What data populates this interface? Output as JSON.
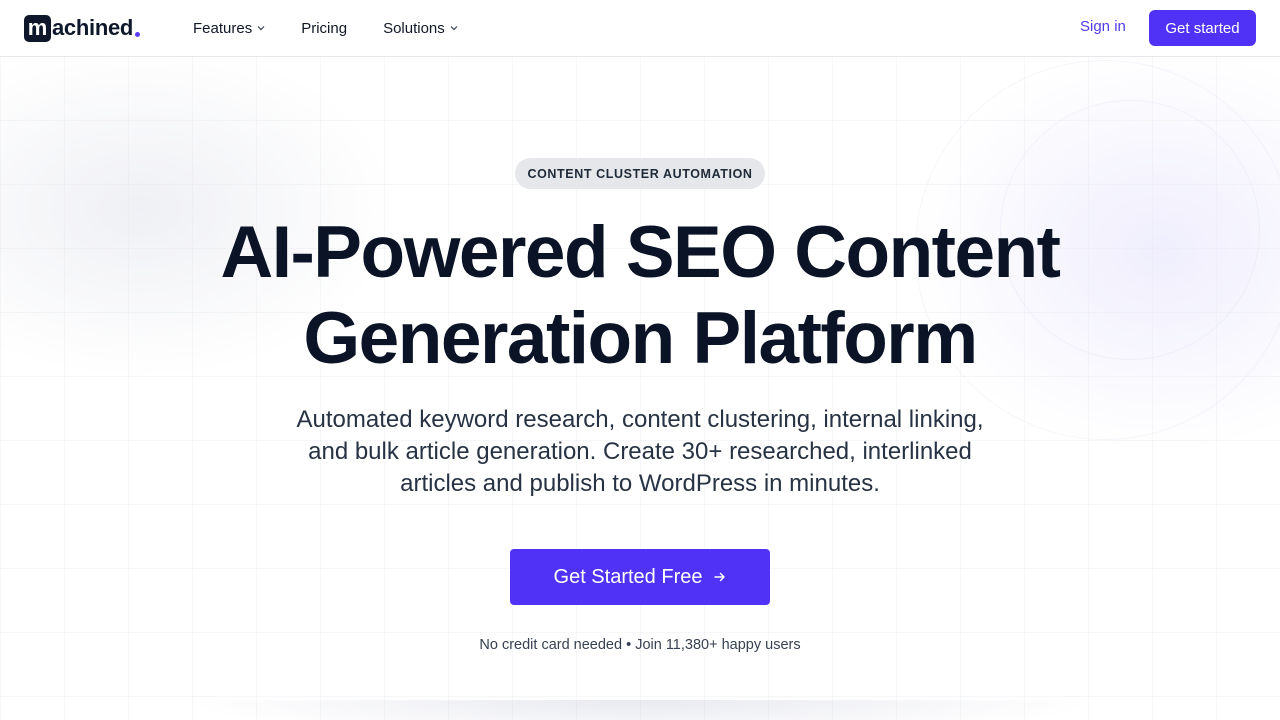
{
  "brand": {
    "logo_mark": "m",
    "logo_rest": "achined",
    "accent_color": "#4f32f6"
  },
  "nav": {
    "items": [
      {
        "label": "Features",
        "has_dropdown": true
      },
      {
        "label": "Pricing",
        "has_dropdown": false
      },
      {
        "label": "Solutions",
        "has_dropdown": true
      }
    ],
    "sign_in": "Sign in",
    "get_started": "Get started"
  },
  "hero": {
    "badge": "CONTENT CLUSTER AUTOMATION",
    "title_line1": "AI-Powered SEO Content",
    "title_line2": "Generation Platform",
    "subtitle_line1": "Automated keyword research, content clustering, internal linking,",
    "subtitle_line2": "and bulk article generation. Create 30+ researched, interlinked",
    "subtitle_line3": "articles and publish to WordPress in minutes.",
    "cta_label": "Get Started Free",
    "cta_icon": "arrow-right-icon",
    "note": "No credit card needed • Join 11,380+ happy users"
  }
}
